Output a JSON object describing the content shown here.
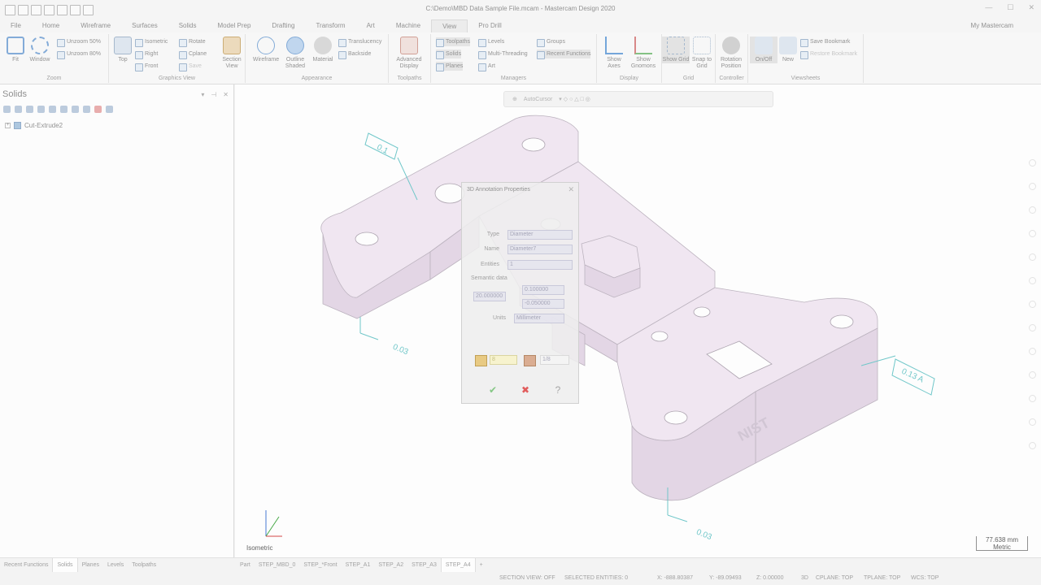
{
  "window": {
    "title": "C:\\Demo\\MBD Data Sample File.mcam - Mastercam Design 2020"
  },
  "tabs": [
    "File",
    "Home",
    "Wireframe",
    "Surfaces",
    "Solids",
    "Model Prep",
    "Drafting",
    "Transform",
    "Art",
    "Machine",
    "View",
    "Pro Drill"
  ],
  "active_tab": "View",
  "account": "My Mastercam",
  "ribbon": {
    "zoom": {
      "label": "Zoom",
      "fit": "Fit",
      "window": "Window",
      "unzoom50": "Unzoom 50%",
      "unzoom80": "Unzoom 80%"
    },
    "graphics_view": {
      "label": "Graphics View",
      "top": "Top",
      "isometric": "Isometric",
      "right": "Right",
      "front": "Front",
      "rotate": "Rotate",
      "cplane": "Cplane",
      "save": "Save",
      "section_view": "Section View"
    },
    "appearance": {
      "label": "Appearance",
      "wireframe": "Wireframe",
      "outline_shaded": "Outline Shaded",
      "material": "Material",
      "translucency": "Translucency",
      "backside": "Backside"
    },
    "toolpaths": {
      "label": "Toolpaths",
      "advanced_display": "Advanced Display"
    },
    "managers": {
      "label": "Managers",
      "toolpaths": "Toolpaths",
      "solids": "Solids",
      "planes": "Planes",
      "levels": "Levels",
      "multi_threading": "Multi-Threading",
      "art": "Art",
      "groups": "Groups",
      "recent_functions": "Recent Functions"
    },
    "display": {
      "label": "Display",
      "show_axes": "Show Axes",
      "show_gnomons": "Show Gnomons"
    },
    "grid": {
      "label": "Grid",
      "show_grid": "Show Grid",
      "snap_to_grid": "Snap to Grid"
    },
    "controller": {
      "label": "Controller",
      "rotation_position": "Rotation Position"
    },
    "viewsheets": {
      "label": "Viewsheets",
      "on_off": "On/Off",
      "new": "New",
      "save_bookmark": "Save Bookmark",
      "restore_bookmark": "Restore Bookmark"
    }
  },
  "left_panel": {
    "title": "Solids",
    "tree": [
      {
        "label": "Cut-Extrude2"
      }
    ]
  },
  "viewport": {
    "autocursor": "AutoCursor",
    "view_name": "Isometric",
    "scale_value": "77.638 mm",
    "scale_unit": "Metric",
    "callouts": {
      "left_top": "0.1",
      "left_mid": "0.03",
      "right": "0.13 A",
      "bottom": "0.03",
      "engraving": "NIST"
    }
  },
  "dialog": {
    "title": "3D Annotation Properties",
    "type_label": "Type",
    "type_value": "Diameter",
    "name_label": "Name",
    "name_value": "Diameter7",
    "entities_label": "Entities",
    "entities_value": "1",
    "semantic_label": "Semantic data",
    "nominal": "20.000000",
    "upper": "0.100000",
    "lower": "-0.050000",
    "units_label": "Units",
    "units_value": "Millimeter",
    "font_size": "8",
    "field_b": "1/8"
  },
  "bottom_tabs": [
    "Recent Functions",
    "Solids",
    "Planes",
    "Levels",
    "Toolpaths"
  ],
  "active_bottom_tab": "Solids",
  "sheet_tabs": [
    "Part",
    "STEP_MBD_0",
    "STEP_*Front",
    "STEP_A1",
    "STEP_A2",
    "STEP_A3",
    "STEP_A4",
    "+"
  ],
  "status": {
    "section_view": "SECTION VIEW: OFF",
    "selected": "SELECTED ENTITIES: 0",
    "x": "X: -888.80387",
    "y": "Y: -89.09493",
    "z": "Z: 0.00000",
    "mode": "3D",
    "cplane": "CPLANE: TOP",
    "tplane": "TPLANE: TOP",
    "wcs": "WCS: TOP"
  },
  "colors": {
    "part_top": "#f0e6f1",
    "part_side": "#e2d4e4",
    "annotation": "#66c4c6",
    "accent": "#2b79c2"
  }
}
